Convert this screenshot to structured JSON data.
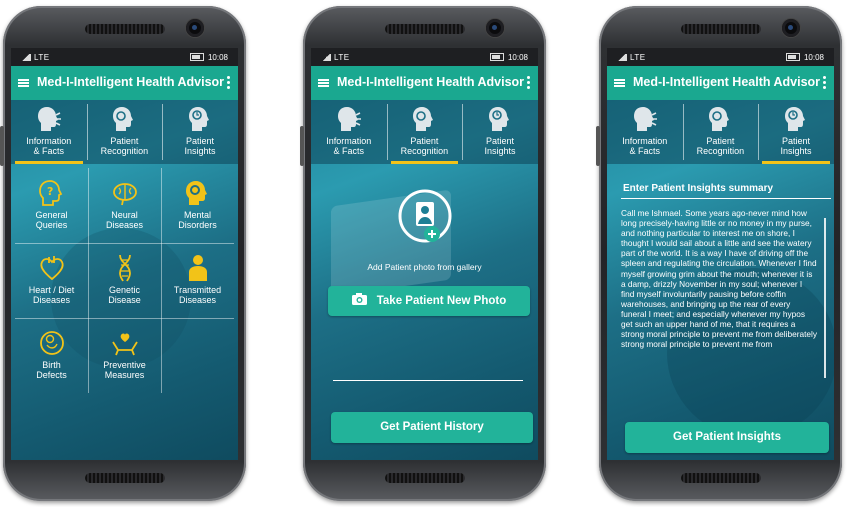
{
  "app_title": "Med-I-Intelligent Health Advisor",
  "status": {
    "network": "LTE",
    "time": "10:08"
  },
  "tabs": [
    {
      "label_l1": "Information",
      "label_l2": "& Facts"
    },
    {
      "label_l1": "Patient",
      "label_l2": "Recognition"
    },
    {
      "label_l1": "Patient",
      "label_l2": "Insights"
    }
  ],
  "categories": [
    {
      "l1": "General",
      "l2": "Queries",
      "icon": "head-question-icon"
    },
    {
      "l1": "Neural",
      "l2": "Diseases",
      "icon": "brain-icon"
    },
    {
      "l1": "Mental",
      "l2": "Disorders",
      "icon": "head-gear-icon"
    },
    {
      "l1": "Heart / Diet",
      "l2": "Diseases",
      "icon": "heart-icon"
    },
    {
      "l1": "Genetic",
      "l2": "Disease",
      "icon": "dna-icon"
    },
    {
      "l1": "Transmitted",
      "l2": "Diseases",
      "icon": "person-icon"
    },
    {
      "l1": "Birth",
      "l2": "Defects",
      "icon": "baby-icon"
    },
    {
      "l1": "Preventive",
      "l2": "Measures",
      "icon": "hands-heart-icon"
    }
  ],
  "recognition": {
    "add_photo_label": "Add Patient photo from gallery",
    "take_photo_button": "Take Patient New Photo",
    "history_button": "Get Patient History"
  },
  "insights": {
    "summary_label": "Enter Patient Insights summary",
    "summary_text": "Call me Ishmael. Some years ago-never mind how long precisely-having little or no money in my purse, and nothing particular to interest me on shore, I thought I would sail about a little and see the watery part of the world. It is a way I have of driving off the spleen and regulating the circulation. Whenever I find myself growing grim about the mouth; whenever it is a damp, drizzly November in my soul; whenever I find myself involuntarily pausing before coffin warehouses, and bringing up the rear of every funeral I meet; and especially whenever my hypos get such an upper hand of me, that it requires a strong moral principle to prevent me from deliberately strong moral principle to prevent me from",
    "insights_button": "Get Patient Insights"
  },
  "colors": {
    "accent": "#1aa890",
    "button": "#22b39a",
    "tab_indicator": "#f2c318",
    "icon_yellow": "#f2c318"
  }
}
